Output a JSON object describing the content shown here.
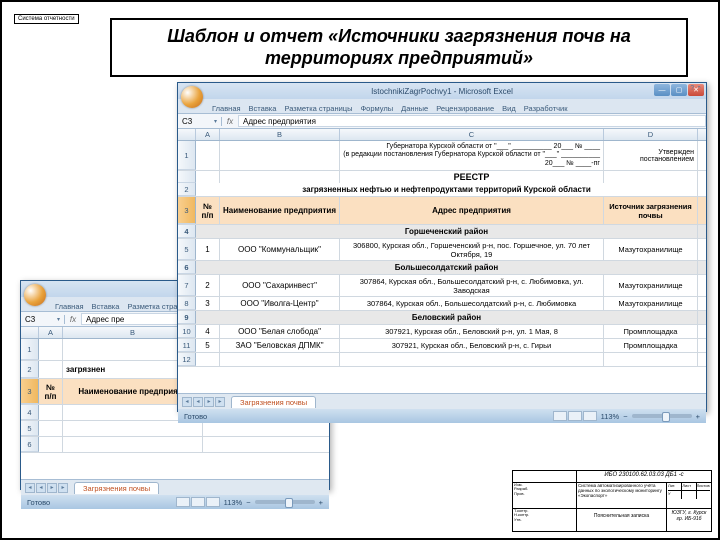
{
  "corner_tag": "Система отчетности",
  "slide_title": "Шаблон и отчет «Источники загрязнения почв на территориях предприятий»",
  "front": {
    "window_title": "IstochnikiZagrPochvy1 - Microsoft Excel",
    "ribbon_tabs": [
      "Главная",
      "Вставка",
      "Разметка страницы",
      "Формулы",
      "Данные",
      "Рецензирование",
      "Вид",
      "Разработчик"
    ],
    "name_box": "C3",
    "fx_label": "fx",
    "formula_value": "Адрес предприятия",
    "columns": [
      "",
      "A",
      "B",
      "C",
      "D"
    ],
    "approval_lines": [
      "Утвержден постановлением",
      "Губернатора Курской области от \"___\" __________ 20___ № ____",
      "(в редакции постановления Губернатора Курской области от \"___\" __________ 20___ № ____-пг"
    ],
    "reestr_title": "РЕЕСТР",
    "reestr_sub": "загрязненных нефтью и нефтепродуктами территорий Курской области",
    "headers": {
      "num": "№ п/п",
      "name": "Наименование предприятия",
      "addr": "Адрес предприятия",
      "src": "Источник загрязнения почвы"
    },
    "groups": [
      "Горшеченский район",
      "Большесолдатский район",
      "Беловский район"
    ],
    "rows": [
      {
        "n": "1",
        "name": "ООО \"Коммунальщик\"",
        "addr": "306800, Курская обл., Горшеченский р-н, пос. Горшечное, ул. 70 лет Октября, 19",
        "src": "Мазутохранилище",
        "group": 0
      },
      {
        "n": "2",
        "name": "ООО \"Сахаринвест\"",
        "addr": "307864, Курская обл., Большесолдатский р-н, с. Любимовка, ул. Заводская",
        "src": "Мазутохранилище",
        "group": 1
      },
      {
        "n": "3",
        "name": "ООО \"Иволга-Центр\"",
        "addr": "307864, Курская обл., Большесолдатский р-н, с. Любимовка",
        "src": "Мазутохранилище",
        "group": 1
      },
      {
        "n": "4",
        "name": "ООО \"Белая слобода\"",
        "addr": "307921, Курская обл., Беловский р-н, ул. 1 Мая, 8",
        "src": "Промплощадка",
        "group": 2
      },
      {
        "n": "5",
        "name": "ЗАО \"Беловская ДПМК\"",
        "addr": "307921, Курская обл., Беловский р-н, с. Гирьи",
        "src": "Промплощадка",
        "group": 2
      }
    ],
    "row_numbers": [
      "1",
      "",
      "",
      "2",
      "3",
      "4",
      "5",
      "6",
      "7",
      "8",
      "9",
      "10",
      "11",
      "12"
    ],
    "sheet_tab": "Загрязнения почвы",
    "status_ready": "Готово",
    "zoom": "113%"
  },
  "back": {
    "window_title": "",
    "ribbon_tabs": [
      "Главная",
      "Вставка",
      "Разметка страницы"
    ],
    "name_box": "C3",
    "formula_value": "Адрес пре",
    "columns": [
      "",
      "A",
      "B"
    ],
    "headers": {
      "num": "№ п/п",
      "name": "Наименование предприяти"
    },
    "partial1": "загрязнен",
    "partial2": "Адрес пр",
    "partial3": "почвы",
    "row_numbers": [
      "1",
      "2",
      "3",
      "4",
      "5",
      "6"
    ],
    "sheet_tab": "Загрязнения почвы",
    "status_ready": "Готово",
    "zoom": "113%"
  },
  "title_block": {
    "code": "ИБО 230100.62.03.03 ДБ1 -с",
    "desc": "Система автоматизированного учёта данных по экологическому мониторингу «Экопаспорт»",
    "tab_label": "Пояснительная записка",
    "size_label": "Лист",
    "sheets_label": "Листов",
    "u_label": "У",
    "lit_label": "Лит.",
    "org": "ЮЗГУ, г. Курск гр. ИБ-91б",
    "roles": [
      "Изм.",
      "Разраб.",
      "Пров.",
      "",
      "",
      "Т.контр.",
      "Н.контр.",
      "Утв."
    ]
  }
}
